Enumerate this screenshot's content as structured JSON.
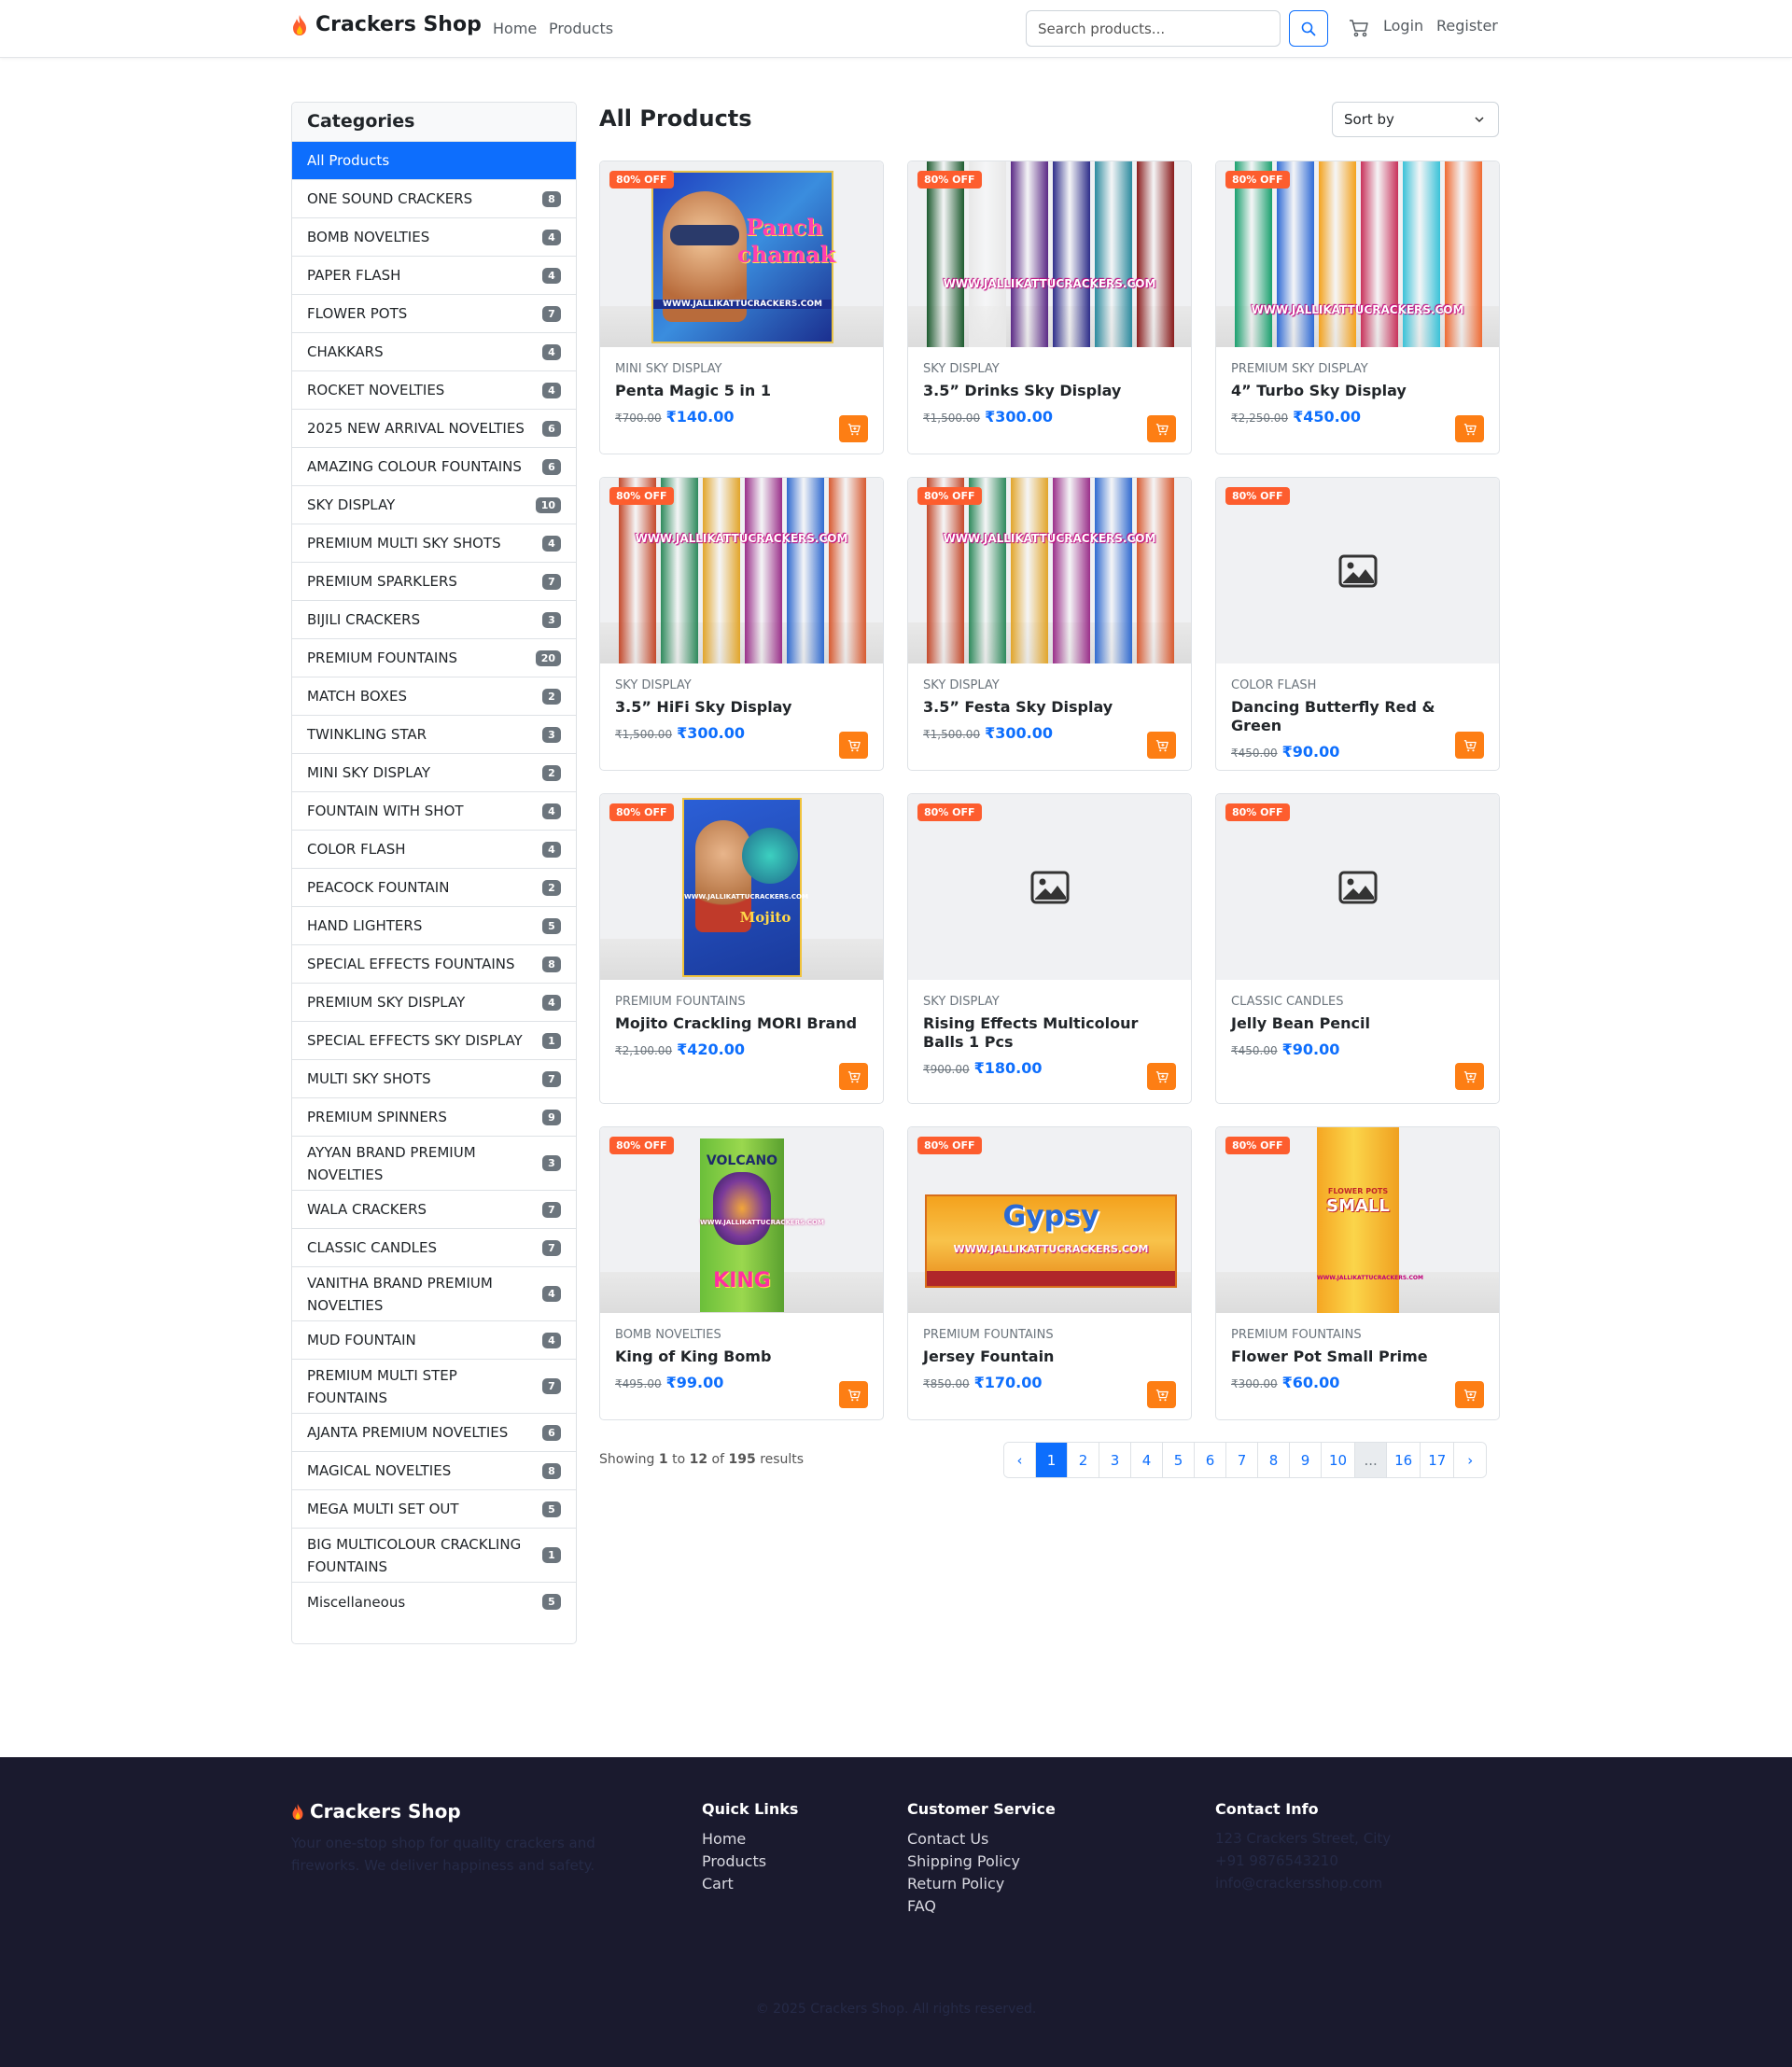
{
  "header": {
    "brand": "Crackers Shop",
    "nav": [
      "Home",
      "Products"
    ],
    "search_placeholder": "Search products...",
    "login": "Login",
    "register": "Register"
  },
  "sidebar": {
    "title": "Categories",
    "items": [
      {
        "label": "All Products",
        "count": "",
        "active": true
      },
      {
        "label": "ONE SOUND CRACKERS",
        "count": "8"
      },
      {
        "label": "BOMB NOVELTIES",
        "count": "4"
      },
      {
        "label": "PAPER FLASH",
        "count": "4"
      },
      {
        "label": "FLOWER POTS",
        "count": "7"
      },
      {
        "label": "CHAKKARS",
        "count": "4"
      },
      {
        "label": "ROCKET NOVELTIES",
        "count": "4"
      },
      {
        "label": "2025 NEW ARRIVAL NOVELTIES",
        "count": "6"
      },
      {
        "label": "AMAZING COLOUR FOUNTAINS",
        "count": "6"
      },
      {
        "label": "SKY DISPLAY",
        "count": "10"
      },
      {
        "label": "PREMIUM MULTI SKY SHOTS",
        "count": "4"
      },
      {
        "label": "PREMIUM SPARKLERS",
        "count": "7"
      },
      {
        "label": "BIJILI CRACKERS",
        "count": "3"
      },
      {
        "label": "PREMIUM FOUNTAINS",
        "count": "20"
      },
      {
        "label": "MATCH BOXES",
        "count": "2"
      },
      {
        "label": "TWINKLING STAR",
        "count": "3"
      },
      {
        "label": "MINI SKY DISPLAY",
        "count": "2"
      },
      {
        "label": "FOUNTAIN WITH SHOT",
        "count": "4"
      },
      {
        "label": "COLOR FLASH",
        "count": "4"
      },
      {
        "label": "PEACOCK FOUNTAIN",
        "count": "2"
      },
      {
        "label": "HAND LIGHTERS",
        "count": "5"
      },
      {
        "label": "SPECIAL EFFECTS FOUNTAINS",
        "count": "8"
      },
      {
        "label": "PREMIUM SKY DISPLAY",
        "count": "4"
      },
      {
        "label": "SPECIAL EFFECTS SKY DISPLAY",
        "count": "1"
      },
      {
        "label": "MULTI SKY SHOTS",
        "count": "7"
      },
      {
        "label": "PREMIUM SPINNERS",
        "count": "9"
      },
      {
        "label": "AYYAN BRAND PREMIUM NOVELTIES",
        "count": "3"
      },
      {
        "label": "WALA CRACKERS",
        "count": "7"
      },
      {
        "label": "CLASSIC CANDLES",
        "count": "7"
      },
      {
        "label": "VANITHA BRAND PREMIUM NOVELTIES",
        "count": "4"
      },
      {
        "label": "MUD FOUNTAIN",
        "count": "4"
      },
      {
        "label": "PREMIUM MULTI STEP FOUNTAINS",
        "count": "7"
      },
      {
        "label": "AJANTA PREMIUM NOVELTIES",
        "count": "6"
      },
      {
        "label": "MAGICAL NOVELTIES",
        "count": "8"
      },
      {
        "label": "MEGA MULTI SET OUT",
        "count": "5"
      },
      {
        "label": "BIG MULTICOLOUR CRACKLING FOUNTAINS",
        "count": "1"
      },
      {
        "label": "Miscellaneous",
        "count": "5"
      }
    ]
  },
  "main": {
    "title": "All Products",
    "sort_label": "Sort by",
    "products": [
      {
        "category": "MINI SKY DISPLAY",
        "name": "Penta Magic 5 in 1",
        "old_price": "₹700.00",
        "price": "₹140.00",
        "discount": "80% OFF",
        "image": "box-panch"
      },
      {
        "category": "SKY DISPLAY",
        "name": "3.5” Drinks Sky Display",
        "old_price": "₹1,500.00",
        "price": "₹300.00",
        "discount": "80% OFF",
        "image": "tubes-drinks"
      },
      {
        "category": "PREMIUM SKY DISPLAY",
        "name": "4” Turbo Sky Display",
        "old_price": "₹2,250.00",
        "price": "₹450.00",
        "discount": "80% OFF",
        "image": "tubes-turbo"
      },
      {
        "category": "SKY DISPLAY",
        "name": "3.5” HiFi Sky Display",
        "old_price": "₹1,500.00",
        "price": "₹300.00",
        "discount": "80% OFF",
        "image": "tubes-hifi"
      },
      {
        "category": "SKY DISPLAY",
        "name": "3.5” Festa Sky Display",
        "old_price": "₹1,500.00",
        "price": "₹300.00",
        "discount": "80% OFF",
        "image": "tubes-hifi"
      },
      {
        "category": "COLOR FLASH",
        "name": "Dancing Butterfly Red & Green",
        "old_price": "₹450.00",
        "price": "₹90.00",
        "discount": "80% OFF",
        "image": "placeholder"
      },
      {
        "category": "PREMIUM FOUNTAINS",
        "name": "Mojito Crackling MORI Brand",
        "old_price": "₹2,100.00",
        "price": "₹420.00",
        "discount": "80% OFF",
        "image": "box-mojito"
      },
      {
        "category": "SKY DISPLAY",
        "name": "Rising Effects Multicolour Balls 1 Pcs",
        "old_price": "₹900.00",
        "price": "₹180.00",
        "discount": "80% OFF",
        "image": "placeholder"
      },
      {
        "category": "CLASSIC CANDLES",
        "name": "Jelly Bean Pencil",
        "old_price": "₹450.00",
        "price": "₹90.00",
        "discount": "80% OFF",
        "image": "placeholder"
      },
      {
        "category": "BOMB NOVELTIES",
        "name": "King of King Bomb",
        "old_price": "₹495.00",
        "price": "₹99.00",
        "discount": "80% OFF",
        "image": "box-king"
      },
      {
        "category": "PREMIUM FOUNTAINS",
        "name": "Jersey Fountain",
        "old_price": "₹850.00",
        "price": "₹170.00",
        "discount": "80% OFF",
        "image": "box-gypsy"
      },
      {
        "category": "PREMIUM FOUNTAINS",
        "name": "Flower Pot Small Prime",
        "old_price": "₹300.00",
        "price": "₹60.00",
        "discount": "80% OFF",
        "image": "box-small"
      }
    ],
    "image_texts": {
      "watermark": "WWW.JALLIKATTUCRACKERS.COM",
      "panch": "Panch chamak",
      "mojito": "Mojito",
      "king": "KING",
      "volcano": "VOLCANO",
      "gypsy": "Gypsy",
      "small": "SMALL",
      "flower_pots": "FLOWER POTS"
    },
    "showing": {
      "prefix": "Showing",
      "from": "1",
      "to_word": "to",
      "to": "12",
      "of_word": "of",
      "total": "195",
      "suffix": "results"
    },
    "pagination": [
      "‹",
      "1",
      "2",
      "3",
      "4",
      "5",
      "6",
      "7",
      "8",
      "9",
      "10",
      "...",
      "16",
      "17",
      "›"
    ]
  },
  "footer": {
    "brand": "Crackers Shop",
    "description": "Your one-stop shop for quality crackers and fireworks. We deliver happiness and safety.",
    "quick_links_title": "Quick Links",
    "quick_links": [
      "Home",
      "Products",
      "Cart"
    ],
    "service_title": "Customer Service",
    "service_links": [
      "Contact Us",
      "Shipping Policy",
      "Return Policy",
      "FAQ"
    ],
    "contact_title": "Contact Info",
    "contact": [
      "123 Crackers Street, City",
      "+91 9876543210",
      "info@crackersshop.com"
    ],
    "copyright": "© 2025 Crackers Shop. All rights reserved."
  },
  "colors": {
    "primary": "#0d6efd",
    "discount": "#fd5d2e",
    "cart_button": "#fd7e14",
    "footer_bg": "#1a1a2e"
  }
}
